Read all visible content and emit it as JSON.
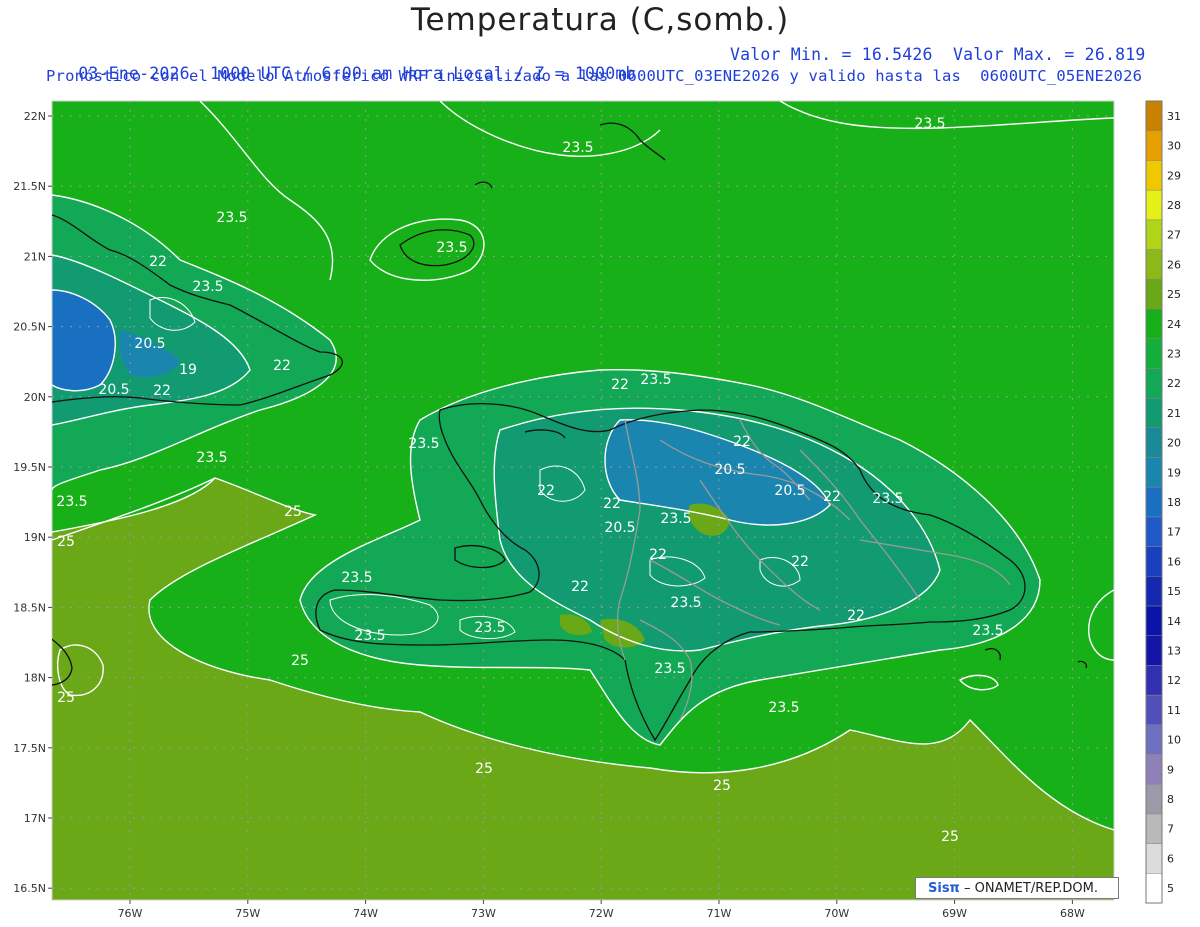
{
  "header": {
    "title": "Temperatura (C,somb.)",
    "line1_left": "03-Ene-2026  1000 UTC / 6:00 am Hora Local / Z = 1000mb",
    "line1_right": "Valor Min. = 16.5426  Valor Max. = 26.819",
    "line2": "Pronóstico con el Modelo Atmosferico WRF inicializado a las 0600UTC_03ENE2026 y valido hasta las  0600UTC_05ENE2026"
  },
  "credit": {
    "logo": "Sisπ",
    "text": "– ONAMET/REP.DOM."
  },
  "axes": {
    "lat_labels": [
      "22N",
      "21.5N",
      "21N",
      "20.5N",
      "20N",
      "19.5N",
      "19N",
      "18.5N",
      "18N",
      "17.5N",
      "17N",
      "16.5N"
    ],
    "lat_values": [
      22,
      21.5,
      21,
      20.5,
      20,
      19.5,
      19,
      18.5,
      18,
      17.5,
      17,
      16.5
    ],
    "lon_labels": [
      "76W",
      "75W",
      "74W",
      "73W",
      "72W",
      "71W",
      "70W",
      "69W",
      "68W"
    ],
    "lon_values": [
      -76,
      -75,
      -74,
      -73,
      -72,
      -71,
      -70,
      -69,
      -68
    ]
  },
  "colorbar": {
    "labels": [
      "5",
      "6",
      "7",
      "8",
      "9",
      "10",
      "11",
      "12",
      "13",
      "14",
      "15",
      "16",
      "17",
      "18",
      "19",
      "20",
      "21",
      "22",
      "23",
      "24",
      "25",
      "26",
      "27",
      "28",
      "29",
      "30",
      "31"
    ],
    "colors": [
      "#ffffff",
      "#dcdcdc",
      "#b9b9b9",
      "#9a9aa8",
      "#9080b8",
      "#7070c0",
      "#5050b8",
      "#3030b0",
      "#1414a8",
      "#0a14a8",
      "#1428b0",
      "#1a40c0",
      "#1e5ac8",
      "#1a70c0",
      "#1a86b0",
      "#1a8a98",
      "#129a70",
      "#12a856",
      "#12b03a",
      "#18b018",
      "#6aa818",
      "#8cb818",
      "#b0d418",
      "#e6f018",
      "#f0c800",
      "#e6a000",
      "#c88200"
    ],
    "levels_low": 5,
    "levels_high": 31
  },
  "contour_labels": [
    {
      "text": "23.5"
    },
    {
      "text": "23.5"
    },
    {
      "text": "23.5"
    },
    {
      "text": "23.5"
    },
    {
      "text": "23.5"
    },
    {
      "text": "23.5"
    },
    {
      "text": "23.5"
    },
    {
      "text": "23.5"
    },
    {
      "text": "23.5"
    },
    {
      "text": "23.5"
    },
    {
      "text": "23.5"
    },
    {
      "text": "23.5"
    },
    {
      "text": "23.5"
    },
    {
      "text": "23.5"
    },
    {
      "text": "23.5"
    },
    {
      "text": "22"
    },
    {
      "text": "22"
    },
    {
      "text": "22"
    },
    {
      "text": "22"
    },
    {
      "text": "22"
    },
    {
      "text": "22"
    },
    {
      "text": "22"
    },
    {
      "text": "22"
    },
    {
      "text": "22"
    },
    {
      "text": "22"
    },
    {
      "text": "22"
    },
    {
      "text": "22"
    },
    {
      "text": "20.5"
    },
    {
      "text": "20.5"
    },
    {
      "text": "20.5"
    },
    {
      "text": "20.5"
    },
    {
      "text": "20.5"
    },
    {
      "text": "19"
    },
    {
      "text": "25"
    },
    {
      "text": "25"
    },
    {
      "text": "25"
    },
    {
      "text": "25"
    },
    {
      "text": "25"
    },
    {
      "text": "25"
    },
    {
      "text": "25"
    },
    {
      "text": "23.5"
    },
    {
      "text": "23.5"
    },
    {
      "text": "23.5"
    }
  ]
}
